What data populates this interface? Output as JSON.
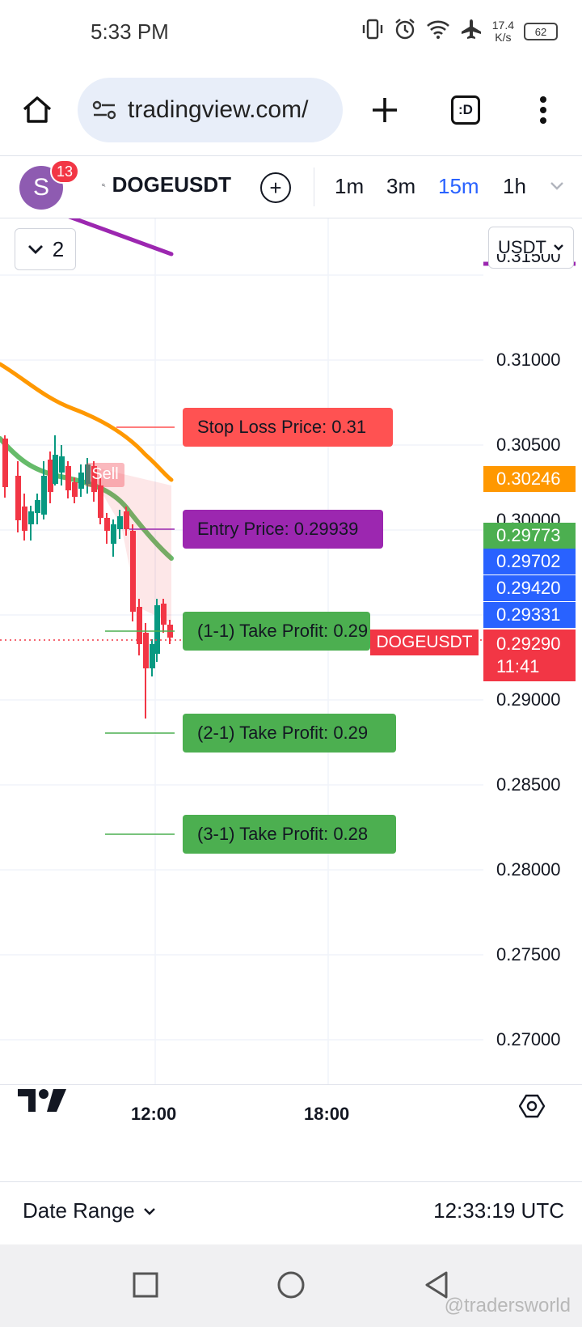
{
  "status_bar": {
    "time": "5:33 PM",
    "net_speed_value": "17.4",
    "net_speed_unit": "K/s",
    "battery": "62"
  },
  "browser": {
    "url": "tradingview.com/",
    "tab_switcher_label": ":D"
  },
  "toolbar": {
    "avatar_letter": "S",
    "notification_count": "13",
    "symbol": "DOGEUSDT",
    "intervals": [
      "1m",
      "3m",
      "15m",
      "1h"
    ],
    "active_interval": "15m"
  },
  "chart": {
    "collapse_count": "2",
    "currency": "USDT",
    "symbol_label": "DOGEUSDT",
    "countdown": "11:41",
    "signal_label": "Sell",
    "price_tags": [
      {
        "text": "0.30246",
        "color": "#ff9800"
      },
      {
        "text": "0.29773",
        "color": "#4caf50"
      },
      {
        "text": "0.29702",
        "color": "#2962ff"
      },
      {
        "text": "0.29420",
        "color": "#2962ff"
      },
      {
        "text": "0.29331",
        "color": "#2962ff"
      },
      {
        "text": "0.29290",
        "color": "#f23645"
      }
    ],
    "axis_ticks": [
      "0.31500",
      "0.31000",
      "0.30500",
      "0.30000",
      "0.29000",
      "0.28500",
      "0.28000",
      "0.27500",
      "0.27000"
    ],
    "time_ticks": [
      "12:00",
      "18:00"
    ],
    "orders": [
      {
        "text": "Stop Loss Price: 0.31",
        "color": "#ff5252"
      },
      {
        "text": "Entry Price: 0.29939",
        "color": "#9c27b0"
      },
      {
        "text": "(1-1) Take Profit: 0.29",
        "color": "#4caf50"
      },
      {
        "text": "(2-1) Take Profit: 0.29",
        "color": "#4caf50"
      },
      {
        "text": "(3-1) Take Profit: 0.28",
        "color": "#4caf50"
      }
    ]
  },
  "bottom_bar": {
    "date_range_label": "Date Range",
    "utc_time": "12:33:19 UTC"
  },
  "watermark": "@tradersworld"
}
